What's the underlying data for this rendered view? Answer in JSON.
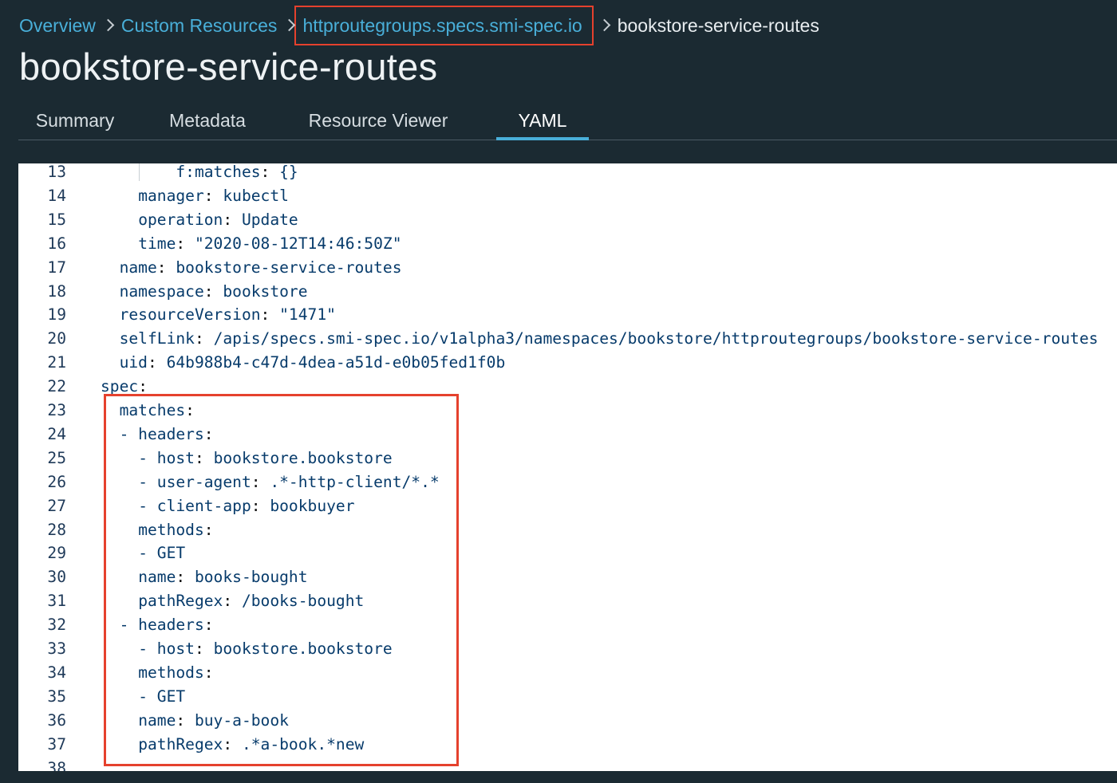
{
  "breadcrumb": {
    "items": [
      "Overview",
      "Custom Resources",
      "httproutegroups.specs.smi-spec.io"
    ],
    "current": "bookstore-service-routes"
  },
  "page_title": "bookstore-service-routes",
  "tabs": [
    {
      "label": "Summary",
      "active": false
    },
    {
      "label": "Metadata",
      "active": false
    },
    {
      "label": "Resource Viewer",
      "active": false
    },
    {
      "label": "YAML",
      "active": true
    }
  ],
  "editor": {
    "lines": [
      {
        "num": "13",
        "indent": "    ",
        "key": "f:matches",
        "sep": ": ",
        "value": "{}"
      },
      {
        "num": "14",
        "indent": "  ",
        "key": "manager",
        "sep": ": ",
        "value": "kubectl"
      },
      {
        "num": "15",
        "indent": "  ",
        "key": "operation",
        "sep": ": ",
        "value": "Update"
      },
      {
        "num": "16",
        "indent": "  ",
        "key": "time",
        "sep": ": ",
        "value": "\"2020-08-12T14:46:50Z\""
      },
      {
        "num": "17",
        "indent": " ",
        "key": "name",
        "sep": ": ",
        "value": "bookstore-service-routes"
      },
      {
        "num": "18",
        "indent": " ",
        "key": "namespace",
        "sep": ": ",
        "value": "bookstore"
      },
      {
        "num": "19",
        "indent": " ",
        "key": "resourceVersion",
        "sep": ": ",
        "value": "\"1471\""
      },
      {
        "num": "20",
        "indent": " ",
        "key": "selfLink",
        "sep": ": ",
        "value": "/apis/specs.smi-spec.io/v1alpha3/namespaces/bookstore/httproutegroups/bookstore-service-routes"
      },
      {
        "num": "21",
        "indent": " ",
        "key": "uid",
        "sep": ": ",
        "value": "64b988b4-c47d-4dea-a51d-e0b05fed1f0b"
      },
      {
        "num": "22",
        "indent": "",
        "key": "spec",
        "sep": ":",
        "value": ""
      },
      {
        "num": "23",
        "indent": " ",
        "key": "matches",
        "sep": ":",
        "value": ""
      },
      {
        "num": "24",
        "indent": " ",
        "key": "- headers",
        "sep": ":",
        "value": ""
      },
      {
        "num": "25",
        "indent": "  ",
        "key": "- host",
        "sep": ": ",
        "value": "bookstore.bookstore"
      },
      {
        "num": "26",
        "indent": "  ",
        "key": "- user-agent",
        "sep": ": ",
        "value": ".*-http-client/*.*"
      },
      {
        "num": "27",
        "indent": "  ",
        "key": "- client-app",
        "sep": ": ",
        "value": "bookbuyer"
      },
      {
        "num": "28",
        "indent": "  ",
        "key": "methods",
        "sep": ":",
        "value": ""
      },
      {
        "num": "29",
        "indent": "  ",
        "key": "- GET",
        "sep": "",
        "value": ""
      },
      {
        "num": "30",
        "indent": "  ",
        "key": "name",
        "sep": ": ",
        "value": "books-bought"
      },
      {
        "num": "31",
        "indent": "  ",
        "key": "pathRegex",
        "sep": ": ",
        "value": "/books-bought"
      },
      {
        "num": "32",
        "indent": " ",
        "key": "- headers",
        "sep": ":",
        "value": ""
      },
      {
        "num": "33",
        "indent": "  ",
        "key": "- host",
        "sep": ": ",
        "value": "bookstore.bookstore"
      },
      {
        "num": "34",
        "indent": "  ",
        "key": "methods",
        "sep": ":",
        "value": ""
      },
      {
        "num": "35",
        "indent": "  ",
        "key": "- GET",
        "sep": "",
        "value": ""
      },
      {
        "num": "36",
        "indent": "  ",
        "key": "name",
        "sep": ": ",
        "value": "buy-a-book"
      },
      {
        "num": "37",
        "indent": "  ",
        "key": "pathRegex",
        "sep": ": ",
        "value": ".*a-book.*new"
      },
      {
        "num": "38",
        "indent": "",
        "key": "",
        "sep": "",
        "value": ""
      }
    ]
  },
  "colors": {
    "background": "#1b2a32",
    "link": "#49afd9",
    "highlight": "#e5412d",
    "code_text": "#073b6b"
  }
}
